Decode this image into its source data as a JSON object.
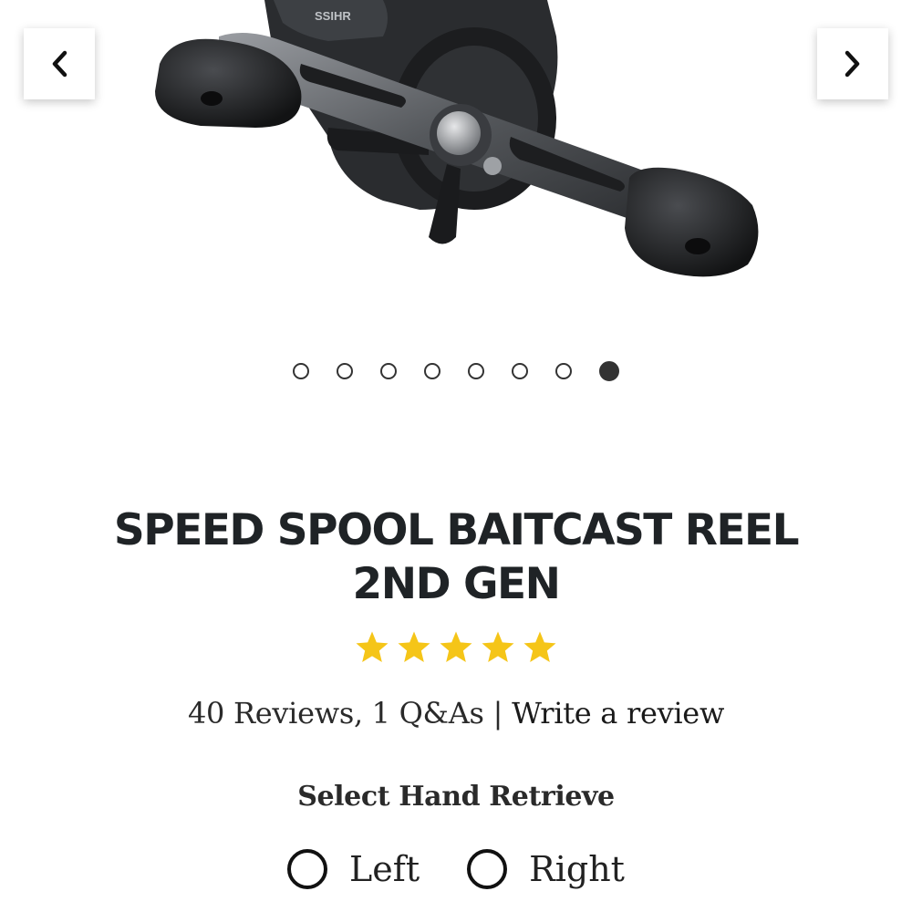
{
  "product": {
    "title_line1": "SPEED SPOOL BAITCAST REEL",
    "title_line2": "2ND GEN",
    "reel_text": "SSIHR"
  },
  "gallery": {
    "prev_icon": "chevron-left-icon",
    "next_icon": "chevron-right-icon",
    "dot_count": 8,
    "active_index": 7
  },
  "rating": {
    "stars": 5,
    "max": 5,
    "color": "#f5c518"
  },
  "reviews": {
    "summary": "40 Reviews, 1 Q&As",
    "separator": "|",
    "write_link": "Write a review"
  },
  "hand_retrieve": {
    "label": "Select Hand Retrieve",
    "options": [
      "Left",
      "Right"
    ]
  }
}
